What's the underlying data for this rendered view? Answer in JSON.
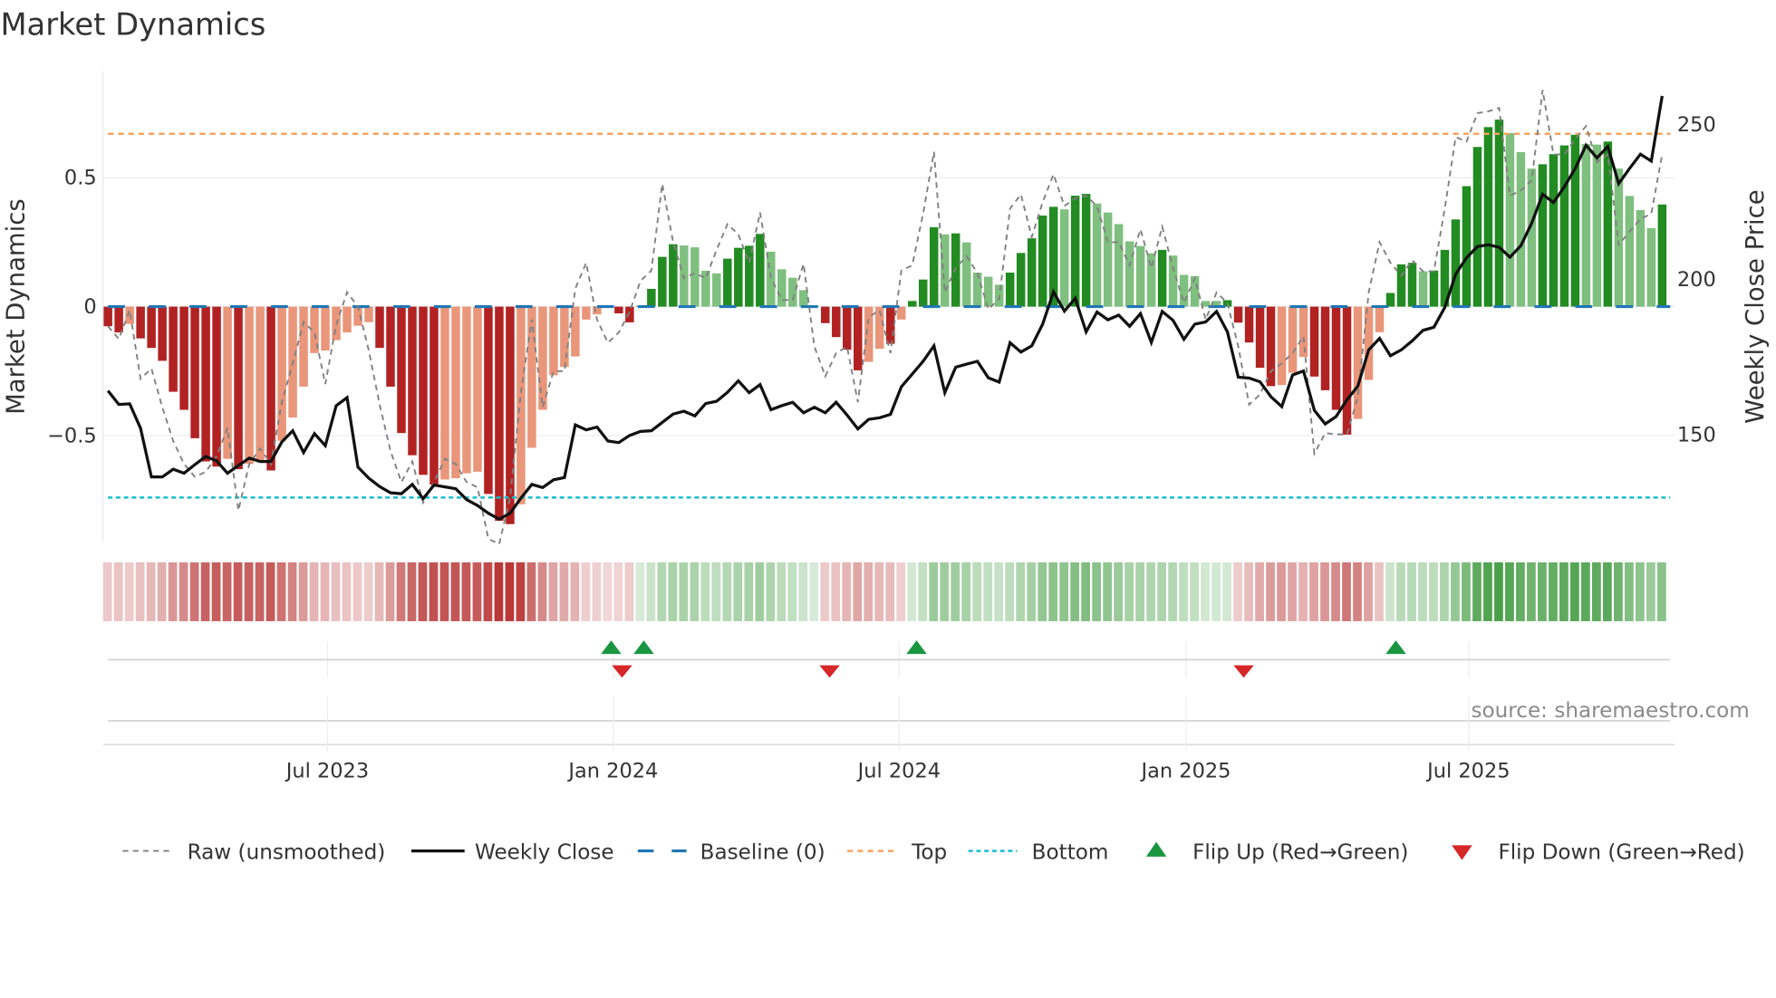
{
  "chart_data": {
    "type": "bar+line",
    "title": "Market Dynamics",
    "ylabel_left": "Market Dynamics",
    "ylabel_right": "Weekly Close Price",
    "ylim_left": [
      -0.9,
      0.9
    ],
    "ylim_right": [
      115.7,
      266.4
    ],
    "left_ticks": [
      {
        "value": 0.5,
        "label": "0.5"
      },
      {
        "value": 0,
        "label": "0"
      },
      {
        "value": -0.5,
        "label": "−0.5"
      }
    ],
    "right_ticks": [
      {
        "value": 250,
        "label": "250"
      },
      {
        "value": 200,
        "label": "200"
      },
      {
        "value": 150,
        "label": "150"
      }
    ],
    "x_unit": "week index",
    "x_ticks": [
      {
        "week": 21.2,
        "label": "Jul 2023"
      },
      {
        "week": 47.5,
        "label": "Jan 2024"
      },
      {
        "week": 73.8,
        "label": "Jul 2024"
      },
      {
        "week": 100.2,
        "label": "Jan 2025"
      },
      {
        "week": 126.2,
        "label": "Jul 2025"
      }
    ],
    "top_level": 0.67,
    "bottom_level": -0.74,
    "baseline": 0,
    "dynamics": [
      -0.076,
      -0.1,
      -0.067,
      -0.123,
      -0.16,
      -0.21,
      -0.33,
      -0.4,
      -0.51,
      -0.6,
      -0.62,
      -0.59,
      -0.63,
      -0.61,
      -0.6,
      -0.635,
      -0.52,
      -0.43,
      -0.31,
      -0.18,
      -0.17,
      -0.13,
      -0.1,
      -0.074,
      -0.06,
      -0.16,
      -0.31,
      -0.49,
      -0.576,
      -0.652,
      -0.69,
      -0.67,
      -0.665,
      -0.646,
      -0.64,
      -0.726,
      -0.83,
      -0.843,
      -0.766,
      -0.547,
      -0.4,
      -0.266,
      -0.234,
      -0.193,
      -0.05,
      -0.03,
      -0.004,
      -0.026,
      -0.061,
      0.003,
      0.069,
      0.193,
      0.242,
      0.237,
      0.23,
      0.139,
      0.129,
      0.186,
      0.228,
      0.236,
      0.282,
      0.213,
      0.145,
      0.112,
      0.064,
      0.005,
      -0.064,
      -0.118,
      -0.167,
      -0.247,
      -0.214,
      -0.163,
      -0.144,
      -0.05,
      0.022,
      0.105,
      0.308,
      0.28,
      0.284,
      0.249,
      0.132,
      0.116,
      0.085,
      0.132,
      0.208,
      0.265,
      0.353,
      0.387,
      0.377,
      0.43,
      0.437,
      0.4,
      0.365,
      0.32,
      0.253,
      0.235,
      0.207,
      0.22,
      0.198,
      0.123,
      0.118,
      0.022,
      0.022,
      0.025,
      -0.062,
      -0.139,
      -0.237,
      -0.308,
      -0.304,
      -0.256,
      -0.195,
      -0.271,
      -0.324,
      -0.4,
      -0.496,
      -0.435,
      -0.284,
      -0.099,
      0.053,
      0.164,
      0.17,
      0.137,
      0.14,
      0.22,
      0.338,
      0.467,
      0.619,
      0.696,
      0.725,
      0.673,
      0.599,
      0.535,
      0.552,
      0.591,
      0.625,
      0.666,
      0.63,
      0.628,
      0.64,
      0.535,
      0.429,
      0.374,
      0.304,
      0.396
    ],
    "strong": [
      1,
      1,
      0,
      1,
      1,
      1,
      1,
      1,
      1,
      1,
      1,
      0,
      1,
      0,
      0,
      1,
      0,
      0,
      0,
      0,
      0,
      0,
      0,
      0,
      0,
      1,
      1,
      1,
      1,
      1,
      1,
      0,
      0,
      0,
      0,
      1,
      1,
      1,
      0,
      0,
      0,
      0,
      0,
      0,
      0,
      0,
      0,
      1,
      1,
      1,
      1,
      1,
      1,
      0,
      0,
      0,
      0,
      1,
      1,
      1,
      1,
      0,
      0,
      0,
      0,
      0,
      1,
      1,
      1,
      1,
      0,
      0,
      1,
      0,
      1,
      1,
      1,
      0,
      1,
      0,
      0,
      0,
      0,
      1,
      1,
      1,
      1,
      1,
      0,
      1,
      1,
      0,
      0,
      0,
      0,
      0,
      0,
      1,
      0,
      0,
      0,
      0,
      0,
      1,
      1,
      1,
      1,
      1,
      0,
      0,
      0,
      1,
      1,
      1,
      1,
      0,
      0,
      0,
      1,
      1,
      1,
      0,
      1,
      1,
      1,
      1,
      1,
      1,
      1,
      0,
      0,
      0,
      1,
      1,
      1,
      1,
      0,
      0,
      1,
      0,
      0,
      0,
      0,
      1
    ],
    "raw": [
      -0.076,
      -0.125,
      -0.014,
      -0.28,
      -0.24,
      -0.39,
      -0.52,
      -0.61,
      -0.66,
      -0.64,
      -0.58,
      -0.47,
      -0.79,
      -0.61,
      -0.55,
      -0.61,
      -0.37,
      -0.22,
      -0.06,
      -0.1,
      -0.3,
      -0.07,
      0.056,
      0.0,
      -0.17,
      -0.38,
      -0.56,
      -0.68,
      -0.6,
      -0.76,
      -0.68,
      -0.59,
      -0.61,
      -0.68,
      -0.7,
      -0.9,
      -0.92,
      -0.74,
      -0.33,
      -0.05,
      -0.39,
      -0.25,
      -0.25,
      0.07,
      0.17,
      -0.05,
      -0.14,
      -0.1,
      -0.02,
      0.1,
      0.14,
      0.476,
      0.25,
      0.11,
      0.13,
      0.11,
      0.22,
      0.32,
      0.28,
      0.17,
      0.365,
      0.113,
      0.026,
      0.026,
      0.166,
      -0.155,
      -0.27,
      -0.18,
      -0.155,
      -0.37,
      -0.04,
      -0.015,
      -0.18,
      0.14,
      0.16,
      0.36,
      0.6,
      0.055,
      0.15,
      0.195,
      0.13,
      -0.01,
      0.03,
      0.38,
      0.435,
      0.27,
      0.405,
      0.513,
      0.39,
      0.42,
      0.43,
      0.39,
      0.25,
      0.25,
      0.16,
      0.3,
      0.15,
      0.31,
      0.15,
      0.014,
      0.11,
      -0.05,
      0.055,
      0.014,
      -0.155,
      -0.38,
      -0.34,
      -0.25,
      -0.22,
      -0.18,
      -0.115,
      -0.57,
      -0.49,
      -0.495,
      -0.495,
      -0.35,
      0.055,
      0.25,
      0.17,
      0.12,
      0.18,
      0.137,
      0.137,
      0.38,
      0.657,
      0.64,
      0.75,
      0.757,
      0.77,
      0.43,
      0.45,
      0.49,
      0.84,
      0.59,
      0.59,
      0.65,
      0.7,
      0.56,
      0.59,
      0.24,
      0.29,
      0.34,
      0.36,
      0.59
    ],
    "close": [
      164.1,
      159.7,
      159.9,
      152,
      136.3,
      136.3,
      138.8,
      137.5,
      140.3,
      142.9,
      141.5,
      137.5,
      140,
      142.4,
      141.3,
      141.3,
      147.6,
      151.2,
      144.2,
      150.3,
      146.4,
      159.3,
      161.9,
      139.5,
      135.9,
      133.2,
      131.2,
      130.9,
      133.9,
      129.3,
      133.7,
      133.1,
      132.5,
      129,
      127.1,
      124.6,
      122.7,
      124.6,
      129.5,
      133.9,
      132.9,
      135.4,
      136.1,
      153.1,
      151.5,
      152.4,
      147.9,
      147.4,
      149.7,
      151,
      151.2,
      153.9,
      156.6,
      157.5,
      156,
      160,
      160.7,
      163.6,
      167.3,
      163.5,
      166.1,
      158,
      159.3,
      160.4,
      157,
      158.8,
      157,
      160.4,
      156.3,
      151.8,
      154.9,
      155.4,
      156.5,
      165.4,
      169.5,
      173.6,
      178.6,
      163.5,
      171.7,
      172.7,
      173.6,
      168.3,
      166.9,
      179.6,
      176.6,
      178.6,
      185.6,
      196,
      189.8,
      193.9,
      183.1,
      189.5,
      187,
      188.5,
      184.9,
      189,
      179.7,
      189.7,
      186.8,
      180.7,
      185.6,
      186.3,
      189.7,
      183.1,
      168.5,
      168.2,
      167,
      162.2,
      159,
      169.2,
      170.5,
      157.8,
      153.4,
      155.8,
      161.2,
      165.6,
      177.3,
      181,
      175.4,
      177.3,
      180.2,
      183.6,
      184.6,
      191,
      201.7,
      207,
      210.6,
      211.2,
      210.4,
      207.2,
      210.9,
      218.2,
      227.5,
      224.8,
      229.9,
      235.8,
      243.3,
      239.2,
      242.9,
      230.9,
      235.8,
      240.4,
      238.2,
      259.2
    ],
    "flip_up_weeks": [
      47.3,
      50.3,
      75.4,
      119.5
    ],
    "flip_down_weeks": [
      48.3,
      67.4,
      105.5
    ],
    "colors": {
      "red_strong": "#b22222",
      "red_light": "#e9967a",
      "green_strong": "#228b22",
      "green_light": "#7fbf7f",
      "raw": "#808080",
      "close": "#111111",
      "baseline": "#1f77b4",
      "top": "#f4a460",
      "bottom": "#17becf",
      "flip_up": "#1a9641",
      "flip_down": "#d62728"
    },
    "legend": [
      {
        "key": "raw",
        "label": "Raw (unsmoothed)"
      },
      {
        "key": "close",
        "label": "Weekly Close"
      },
      {
        "key": "baseline",
        "label": "Baseline (0)"
      },
      {
        "key": "top",
        "label": "Top"
      },
      {
        "key": "bottom",
        "label": "Bottom"
      },
      {
        "key": "flip_up",
        "label": "Flip Up (Red→Green)"
      },
      {
        "key": "flip_down",
        "label": "Flip Down (Green→Red)"
      }
    ],
    "legend_placement": "bottom",
    "source": "source: sharemaestro.com"
  }
}
